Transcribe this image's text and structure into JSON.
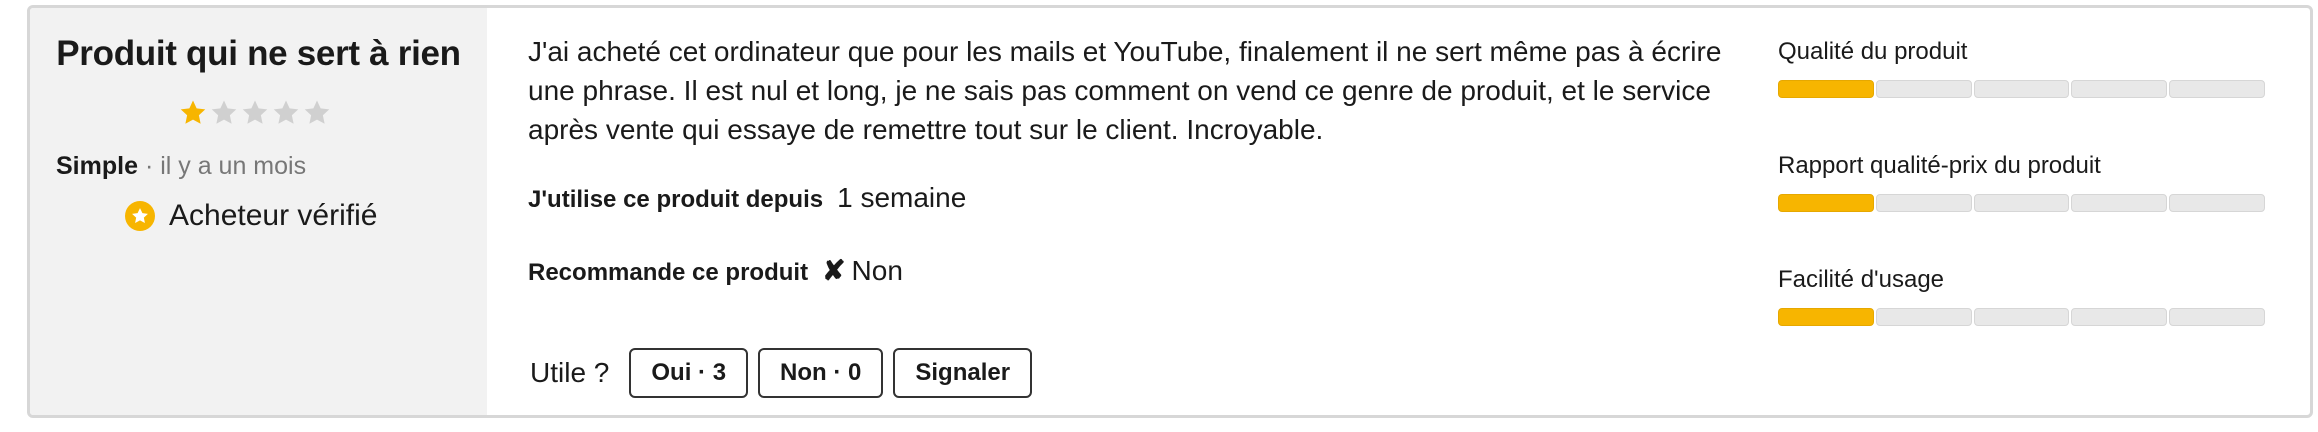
{
  "review": {
    "title": "Produit qui ne sert à rien",
    "rating": 1,
    "rating_max": 5,
    "author": "Simple",
    "date": "· il y a un mois",
    "verified_label": "Acheteur vérifié",
    "text": "J'ai acheté cet ordinateur que pour les mails et YouTube, finalement il ne sert même pas à écrire une phrase. Il est nul et long, je ne sais pas comment on vend ce genre de produit, et le service après vente qui essaye de remettre tout sur le client. Incroyable.",
    "usage_label": "J'utilise ce produit depuis",
    "usage_value": "1 semaine",
    "recommend_label": "Recommande ce produit",
    "recommend_icon": "✘",
    "recommend_value": "Non"
  },
  "helpful": {
    "question": "Utile ?",
    "yes_label": "Oui · 3",
    "no_label": "Non · 0",
    "report_label": "Signaler"
  },
  "sub_ratings": [
    {
      "label": "Qualité du produit",
      "score": 1,
      "max": 5
    },
    {
      "label": "Rapport qualité-prix du produit",
      "score": 1,
      "max": 5
    },
    {
      "label": "Facilité d'usage",
      "score": 1,
      "max": 5
    }
  ],
  "colors": {
    "accent": "#f7b500",
    "left_panel_bg": "#f2f2f2",
    "star_empty": "#d0d0d0"
  }
}
